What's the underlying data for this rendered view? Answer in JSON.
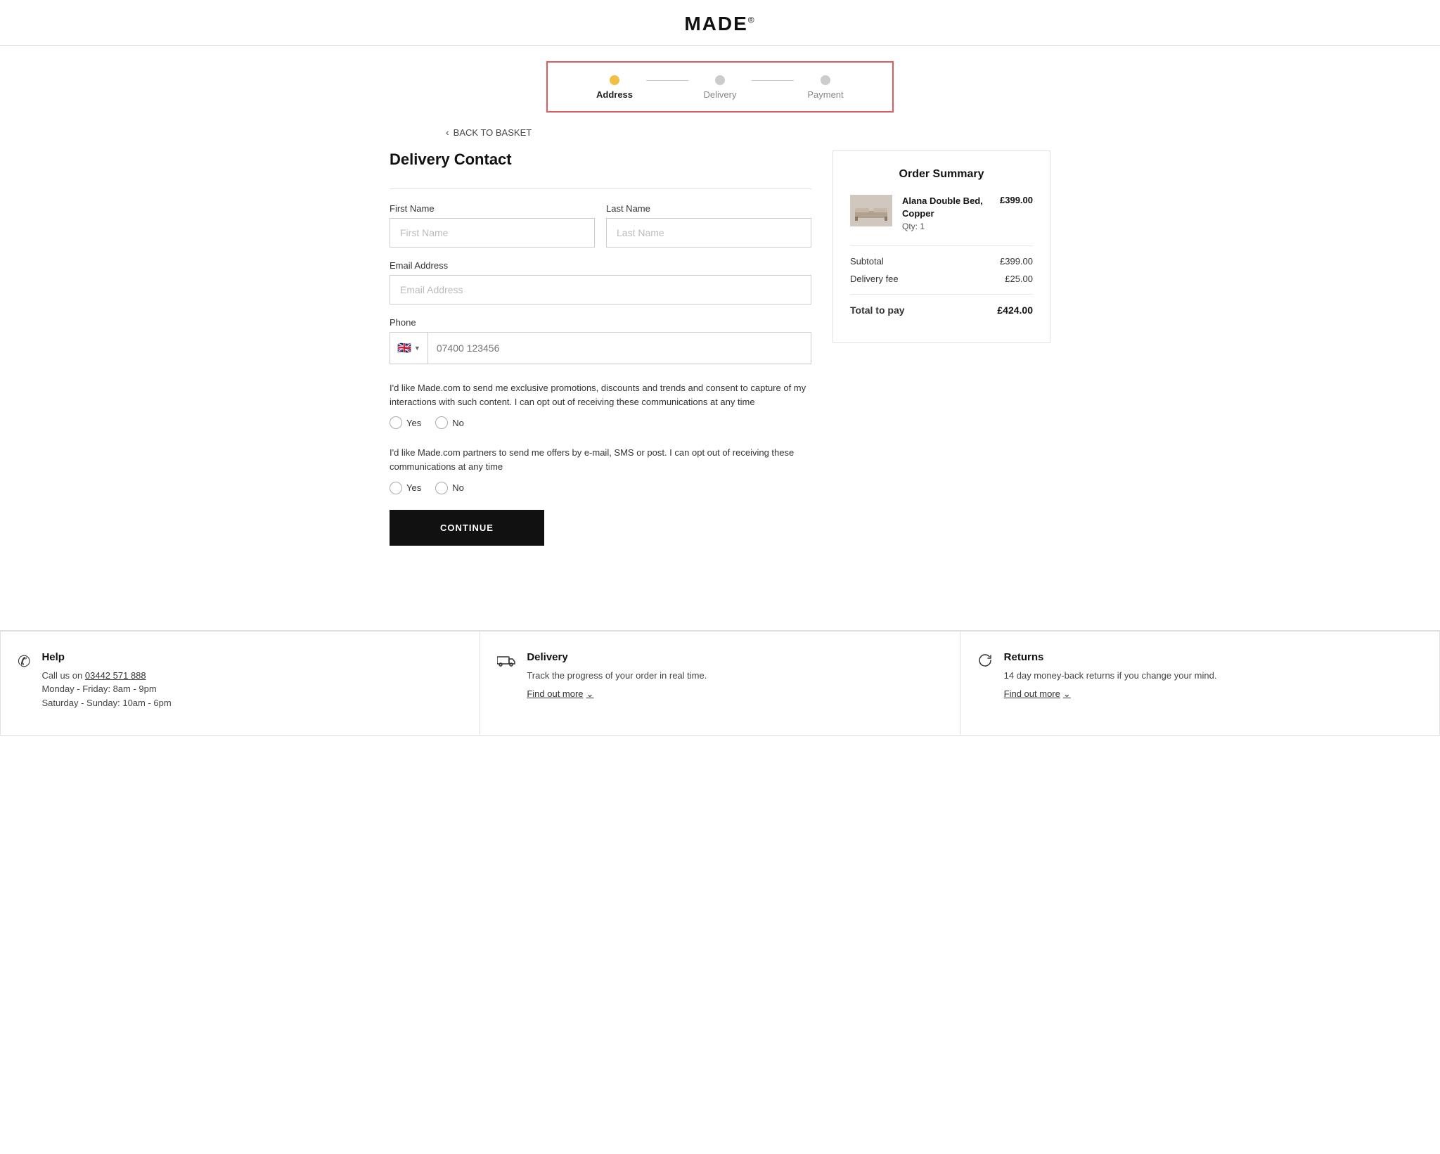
{
  "header": {
    "logo": "MADE",
    "logo_sup": "®"
  },
  "progress": {
    "steps": [
      {
        "label": "Address",
        "active": true
      },
      {
        "label": "Delivery",
        "active": false
      },
      {
        "label": "Payment",
        "active": false
      }
    ]
  },
  "back_link": "BACK TO BASKET",
  "form": {
    "section_title": "Delivery Contact",
    "first_name_label": "First Name",
    "first_name_placeholder": "First Name",
    "last_name_label": "Last Name",
    "last_name_placeholder": "Last Name",
    "email_label": "Email Address",
    "email_placeholder": "Email Address",
    "phone_label": "Phone",
    "phone_placeholder": "07400 123456",
    "phone_flag": "🇬🇧",
    "consent1_text": "I'd like Made.com to send me exclusive promotions, discounts and trends and consent to capture of my interactions with such content. I can opt out of receiving these communications at any time",
    "consent2_text": "I'd like Made.com partners to send me offers by e-mail, SMS or post. I can opt out of receiving these communications at any time",
    "yes_label": "Yes",
    "no_label": "No",
    "continue_label": "CONTINUE"
  },
  "order_summary": {
    "title": "Order Summary",
    "product": {
      "name": "Alana Double Bed, Copper",
      "qty": "Qty: 1",
      "price": "£399.00"
    },
    "subtotal_label": "Subtotal",
    "subtotal_value": "£399.00",
    "delivery_label": "Delivery fee",
    "delivery_value": "£25.00",
    "total_label": "Total to pay",
    "total_value": "£424.00"
  },
  "footer": {
    "cards": [
      {
        "icon": "phone",
        "title": "Help",
        "line1": "Call us on",
        "phone": "03442 571 888",
        "line2": "Monday - Friday: 8am - 9pm",
        "line3": "Saturday - Sunday: 10am - 6pm",
        "find_out_more": null
      },
      {
        "icon": "truck",
        "title": "Delivery",
        "line1": "Track the progress of your order in real time.",
        "find_out_more": "Find out more"
      },
      {
        "icon": "returns",
        "title": "Returns",
        "line1": "14 day money-back returns if you change your mind.",
        "find_out_more": "Find out more"
      }
    ]
  }
}
